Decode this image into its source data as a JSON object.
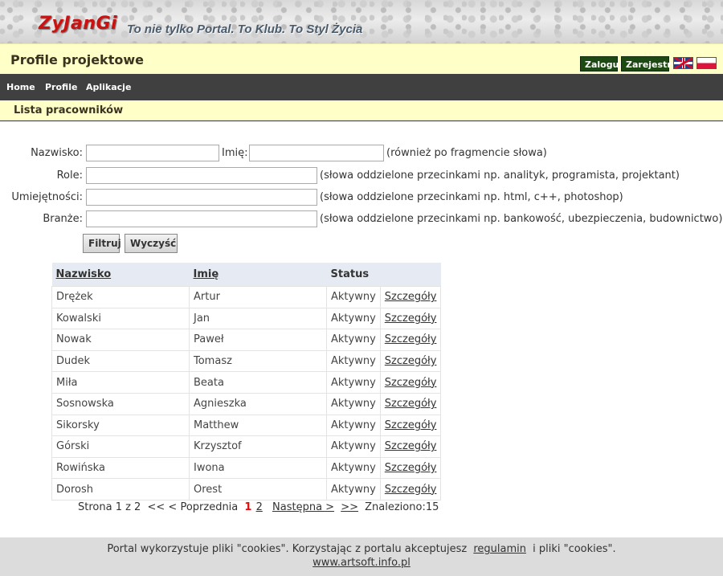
{
  "header": {
    "logo_text": "ZyJanGi",
    "slogan": "To nie tylko Portal. To Klub. To Styl Życia",
    "page_title": "Profile projektowe",
    "login_label": "Zaloguj",
    "register_label": "Zarejestruj",
    "flags": [
      "flag-en-icon",
      "flag-pl-icon"
    ]
  },
  "nav": {
    "items": [
      "Home",
      "Profile",
      "Aplikacje"
    ]
  },
  "section": {
    "title": "Lista pracowników"
  },
  "filter": {
    "surname_label": "Nazwisko:",
    "surname_value": "",
    "name_label": "Imię:",
    "name_value": "",
    "name_hint": "(również po fragmencie słowa)",
    "roles_label": "Role:",
    "roles_value": "",
    "roles_hint": "(słowa oddzielone przecinkami np. analityk, programista, projektant)",
    "skills_label": "Umiejętności:",
    "skills_value": "",
    "skills_hint": "(słowa oddzielone przecinkami np. html, c++, photoshop)",
    "industries_label": "Branże:",
    "industries_value": "",
    "industries_hint": "(słowa oddzielone przecinkami np. bankowość, ubezpieczenia, budownictwo)",
    "filter_button": "Filtruj",
    "clear_button": "Wyczyść"
  },
  "table": {
    "headers": {
      "surname": "Nazwisko",
      "name": "Imię",
      "status": "Status"
    },
    "details_label": "Szczegóły",
    "rows": [
      {
        "surname": "Drężek",
        "name": "Artur",
        "status": "Aktywny"
      },
      {
        "surname": "Kowalski",
        "name": "Jan",
        "status": "Aktywny"
      },
      {
        "surname": "Nowak",
        "name": "Paweł",
        "status": "Aktywny"
      },
      {
        "surname": "Dudek",
        "name": "Tomasz",
        "status": "Aktywny"
      },
      {
        "surname": "Miła",
        "name": "Beata",
        "status": "Aktywny"
      },
      {
        "surname": "Sosnowska",
        "name": "Agnieszka",
        "status": "Aktywny"
      },
      {
        "surname": "Sikorsky",
        "name": "Matthew",
        "status": "Aktywny"
      },
      {
        "surname": "Górski",
        "name": "Krzysztof",
        "status": "Aktywny"
      },
      {
        "surname": "Rowińska",
        "name": "Iwona",
        "status": "Aktywny"
      },
      {
        "surname": "Dorosh",
        "name": "Orest",
        "status": "Aktywny"
      }
    ]
  },
  "pager": {
    "page_info": "Strona 1 z 2",
    "first": "<<",
    "prev": "< Poprzednia",
    "current_page": "1",
    "other_page": "2",
    "next": "Następna >",
    "last": ">>",
    "found": "Znaleziono:15"
  },
  "footer": {
    "cookie_text_before": "Portal wykorzystuje pliki \"cookies\". Korzystając z portalu akceptujesz",
    "regulations_link": "regulamin",
    "cookie_text_after": "i pliki \"cookies\".",
    "site_link": "www.artsoft.info.pl"
  },
  "colors": {
    "banner_bg": "#dcdcdc",
    "logo_red": "#cc1111",
    "title_bar_bg": "#ffffc8",
    "nav_bg": "#404040",
    "auth_button_bg": "#1d4a12",
    "table_header_bg": "#e6ebf3",
    "current_page_red": "#e01010",
    "footer_bg": "#dcdcdc"
  }
}
